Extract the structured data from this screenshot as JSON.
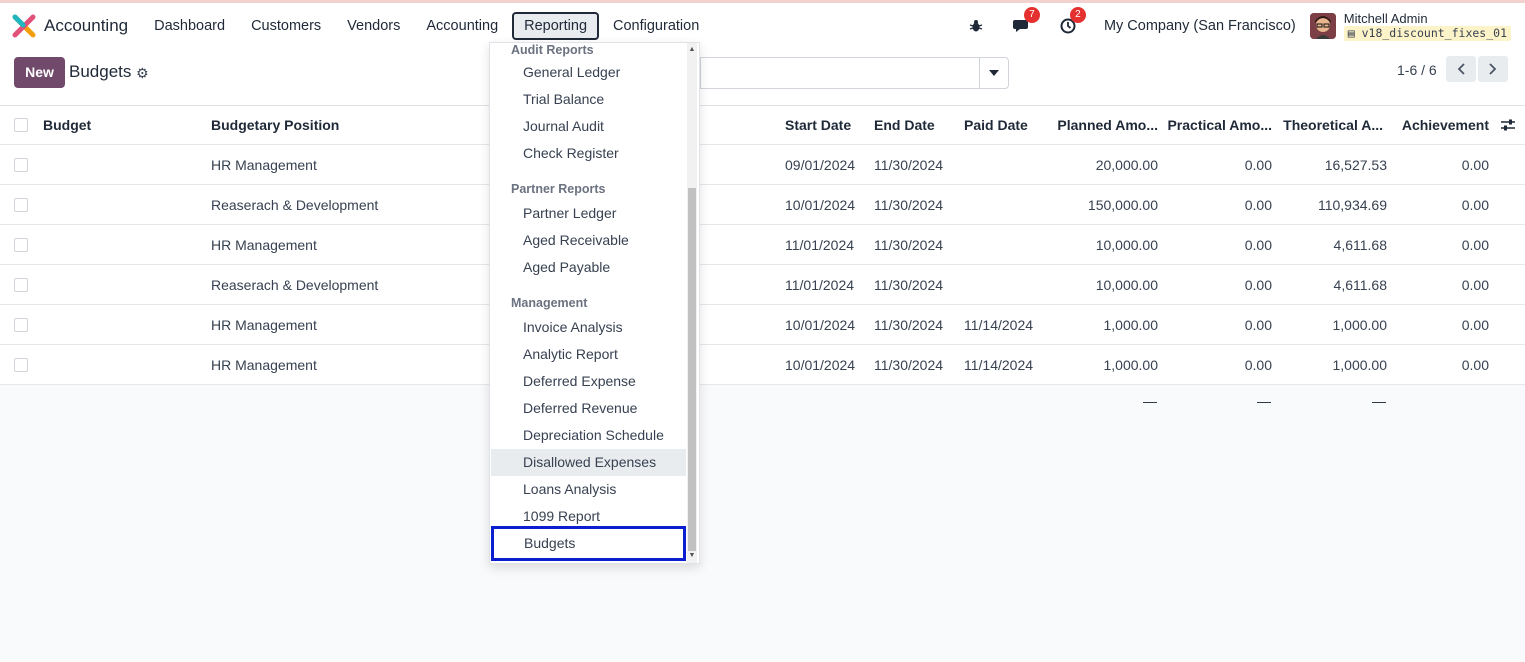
{
  "navbar": {
    "app_name": "Accounting",
    "menu": [
      "Dashboard",
      "Customers",
      "Vendors",
      "Accounting",
      "Reporting",
      "Configuration"
    ],
    "active_menu": "Reporting",
    "messages_badge": "7",
    "activities_badge": "2",
    "company": "My Company (San Francisco)",
    "user_name": "Mitchell Admin",
    "database": "v18_discount_fixes_01",
    "icons": [
      "debug-icon",
      "chat-icon",
      "clock-icon"
    ]
  },
  "control_panel": {
    "new_label": "New",
    "title": "Budgets",
    "search_placeholder": "",
    "pager": "1-6 / 6"
  },
  "table": {
    "columns": [
      "Budget",
      "Budgetary Position",
      "Start Date",
      "End Date",
      "Paid Date",
      "Planned Amo...",
      "Practical Amo...",
      "Theoretical A...",
      "Achievement"
    ],
    "rows": [
      {
        "budget": "",
        "position": "HR Management",
        "start": "09/01/2024",
        "end": "11/30/2024",
        "paid": "",
        "planned": "20,000.00",
        "practical": "0.00",
        "theoretical": "16,527.53",
        "achievement": "0.00"
      },
      {
        "budget": "",
        "position": "Reaserach & Development",
        "start": "10/01/2024",
        "end": "11/30/2024",
        "paid": "",
        "planned": "150,000.00",
        "practical": "0.00",
        "theoretical": "110,934.69",
        "achievement": "0.00"
      },
      {
        "budget": "",
        "position": "HR Management",
        "start": "11/01/2024",
        "end": "11/30/2024",
        "paid": "",
        "planned": "10,000.00",
        "practical": "0.00",
        "theoretical": "4,611.68",
        "achievement": "0.00"
      },
      {
        "budget": "",
        "position": "Reaserach & Development",
        "start": "11/01/2024",
        "end": "11/30/2024",
        "paid": "",
        "planned": "10,000.00",
        "practical": "0.00",
        "theoretical": "4,611.68",
        "achievement": "0.00"
      },
      {
        "budget": "",
        "position": "HR Management",
        "start": "10/01/2024",
        "end": "11/30/2024",
        "paid": "11/14/2024",
        "planned": "1,000.00",
        "practical": "0.00",
        "theoretical": "1,000.00",
        "achievement": "0.00"
      },
      {
        "budget": "",
        "position": "HR Management",
        "start": "10/01/2024",
        "end": "11/30/2024",
        "paid": "11/14/2024",
        "planned": "1,000.00",
        "practical": "0.00",
        "theoretical": "1,000.00",
        "achievement": "0.00"
      }
    ],
    "totals": [
      "—",
      "—",
      "—"
    ]
  },
  "dropdown": {
    "sections": [
      {
        "header": "Audit Reports",
        "items": [
          "General Ledger",
          "Trial Balance",
          "Journal Audit",
          "Check Register"
        ]
      },
      {
        "header": "Partner Reports",
        "items": [
          "Partner Ledger",
          "Aged Receivable",
          "Aged Payable"
        ]
      },
      {
        "header": "Management",
        "items": [
          "Invoice Analysis",
          "Analytic Report",
          "Deferred Expense",
          "Deferred Revenue",
          "Depreciation Schedule",
          "Disallowed Expenses",
          "Loans Analysis",
          "1099 Report",
          "Budgets"
        ]
      }
    ],
    "hovered_item": "Disallowed Expenses",
    "focused_item": "Budgets"
  },
  "colors": {
    "primary": "#71496b",
    "badge": "#e4302f",
    "focus_outline": "#0b1fd0"
  }
}
